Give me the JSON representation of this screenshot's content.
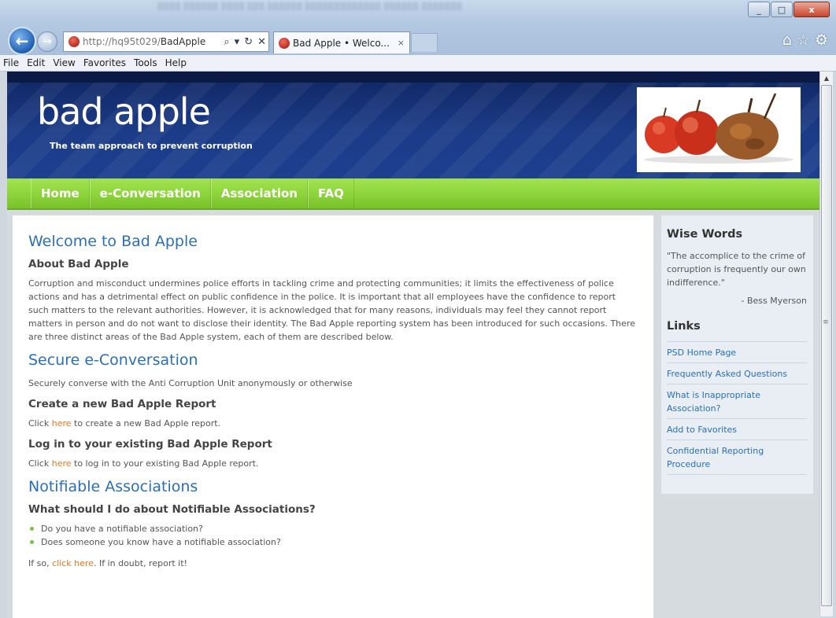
{
  "browser": {
    "address_host": "http://hq95t029/",
    "address_path": "BadApple",
    "tab_title": "Bad Apple • Welco...",
    "tab_close": "×",
    "menu": [
      "File",
      "Edit",
      "View",
      "Favorites",
      "Tools",
      "Help"
    ],
    "icons": {
      "back": "←",
      "forward": "→",
      "search": "⌕",
      "dropdown": "▾",
      "refresh": "↻",
      "stop": "✕",
      "home": "⌂",
      "favorites": "☆",
      "tools": "⚙"
    },
    "window_controls": {
      "minimize": "_",
      "maximize": "□",
      "close": "x"
    }
  },
  "site": {
    "logo_title": "bad apple",
    "logo_tagline": "The team approach to prevent corruption",
    "nav": [
      "Home",
      "e-Conversation",
      "Association",
      "FAQ"
    ]
  },
  "main": {
    "welcome_title": "Welcome to Bad Apple",
    "about_heading": "About Bad Apple",
    "about_text": "Corruption and misconduct undermines police efforts in tackling crime and protecting communities; it limits the effectiveness of police actions and has a detrimental effect on public confidence in the police. It is important that all employees have the confidence to report such matters to the relevant authorities. However, it is acknowledged that for many reasons, individuals may feel they cannot report matters in person and do not want to disclose their identity. The Bad Apple reporting system has been introduced for such occasions. There are three distinct areas of the Bad Apple system, each of them are described below.",
    "secure_title": "Secure e-Conversation",
    "secure_text": "Securely converse with the Anti Corruption Unit anonymously or otherwise",
    "create_heading": "Create a new Bad Apple Report",
    "create_prefix": "Click ",
    "create_link": "here",
    "create_suffix": " to create a new Bad Apple report.",
    "login_heading": "Log in to your existing Bad Apple Report",
    "login_prefix": "Click ",
    "login_link": "here",
    "login_suffix": " to log in to your existing Bad Apple report.",
    "notifiable_title": "Notifiable Associations",
    "notifiable_heading": "What should I do about Notifiable Associations?",
    "notifiable_bullets": [
      "Do you have a notifiable association?",
      "Does someone you know have a notifiable association?"
    ],
    "final_prefix": "If so, ",
    "final_link": "click here",
    "final_suffix": ". If in doubt, report it!"
  },
  "sidebar": {
    "wise_heading": "Wise Words",
    "quote": "\"The accomplice to the crime of corruption is frequently our own indifference.\"",
    "quote_author": "- Bess Myerson",
    "links_heading": "Links",
    "links": [
      "PSD Home Page",
      "Frequently Asked Questions",
      "What is Inappropriate Association?",
      "Add to Favorites",
      "Confidential Reporting Procedure"
    ]
  },
  "colors": {
    "header_blue": "#1b3b87",
    "nav_green": "#8cd43a",
    "link_blue": "#2a6fba",
    "link_orange": "#e6781e",
    "bullet_green": "#7ac142"
  }
}
